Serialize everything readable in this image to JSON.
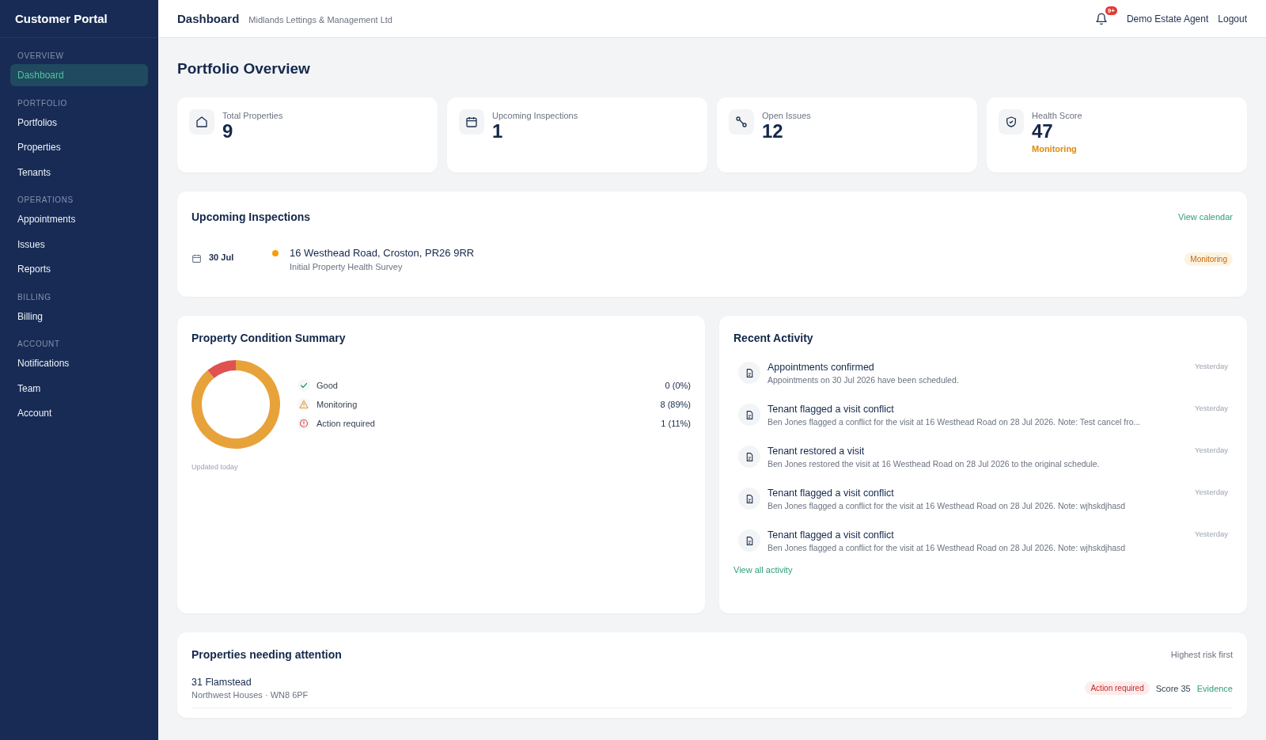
{
  "sidebar": {
    "title": "Customer Portal",
    "sections": [
      {
        "heading": "OVERVIEW",
        "items": [
          {
            "label": "Dashboard",
            "selected": true
          }
        ]
      },
      {
        "heading": "PORTFOLIO",
        "items": [
          {
            "label": "Portfolios",
            "selected": false
          },
          {
            "label": "Properties",
            "selected": false
          },
          {
            "label": "Tenants",
            "selected": false
          }
        ]
      },
      {
        "heading": "OPERATIONS",
        "items": [
          {
            "label": "Appointments",
            "selected": false
          },
          {
            "label": "Issues",
            "selected": false
          },
          {
            "label": "Reports",
            "selected": false
          }
        ]
      },
      {
        "heading": "BILLING",
        "items": [
          {
            "label": "Billing",
            "selected": false
          }
        ]
      },
      {
        "heading": "ACCOUNT",
        "items": [
          {
            "label": "Notifications",
            "selected": false
          },
          {
            "label": "Team",
            "selected": false
          },
          {
            "label": "Account",
            "selected": false
          }
        ]
      }
    ]
  },
  "header": {
    "title": "Dashboard",
    "organization": "Midlands Lettings & Management Ltd",
    "notification_badge": "9+",
    "user": "Demo Estate Agent",
    "logout": "Logout"
  },
  "page_title": "Portfolio Overview",
  "stats": [
    {
      "kind": "house",
      "label": "Total Properties",
      "value": "9"
    },
    {
      "kind": "calendar",
      "label": "Upcoming Inspections",
      "value": "1"
    },
    {
      "kind": "wrench",
      "label": "Open Issues",
      "value": "12"
    },
    {
      "kind": "shield",
      "label": "Health Score",
      "value": "47",
      "status": "Monitoring"
    }
  ],
  "inspections": {
    "title": "Upcoming Inspections",
    "link": "View calendar",
    "items": [
      {
        "date": "30 Jul",
        "address": "16 Westhead Road, Croston, PR26 9RR",
        "survey": "Initial Property Health Survey",
        "badge": "Monitoring",
        "kind": "monitoring"
      }
    ]
  },
  "condition": {
    "title": "Property Condition Summary",
    "chart_data": {
      "type": "donut",
      "categories": [
        "Good",
        "Monitoring",
        "Action required"
      ],
      "values": [
        0,
        89,
        11
      ]
    },
    "legend": [
      {
        "kind": "good",
        "count": "0 (0%)"
      },
      {
        "kind": "monitoring",
        "count": "8 (89%)"
      },
      {
        "kind": "action",
        "count": "1 (11%)"
      }
    ],
    "updated": "Updated today"
  },
  "activity": {
    "title": "Recent Activity",
    "items": [
      {
        "title": "Appointments confirmed",
        "description": "Appointments on 30 Jul 2026 have been scheduled.",
        "time": "Yesterday"
      },
      {
        "title": "Tenant flagged a visit conflict",
        "description": "Ben Jones flagged a conflict for the visit at 16 Westhead Road on 28 Jul 2026. Note: Test cancel fro...",
        "time": "Yesterday"
      },
      {
        "title": "Tenant restored a visit",
        "description": "Ben Jones restored the visit at 16 Westhead Road on 28 Jul 2026 to the original schedule.",
        "time": "Yesterday"
      },
      {
        "title": "Tenant flagged a visit conflict",
        "description": "Ben Jones flagged a conflict for the visit at 16 Westhead Road on 28 Jul 2026. Note: wjhskdjhasd",
        "time": "Yesterday"
      },
      {
        "title": "Tenant flagged a visit conflict",
        "description": "Ben Jones flagged a conflict for the visit at 16 Westhead Road on 28 Jul 2026. Note: wjhskdjhasd",
        "time": "Yesterday"
      }
    ],
    "link": "View all activity"
  },
  "attention": {
    "title": "Properties needing attention",
    "sort": "Highest risk first",
    "rows": [
      {
        "name": "31 Flamstead",
        "subtitle": "Northwest Houses · WN8 6PF",
        "badge": "Action required",
        "kind": "action",
        "score": "Score 35",
        "link": "Evidence"
      }
    ]
  }
}
